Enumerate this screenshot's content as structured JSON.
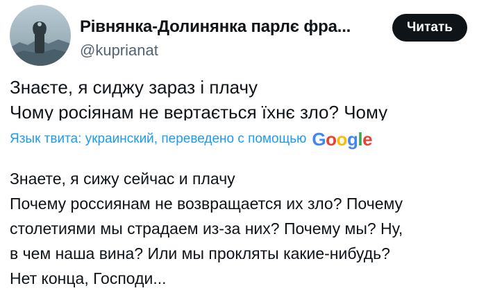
{
  "author": {
    "display_name": "Рівнянка-Долинянка парлє фра...",
    "handle": "@kuprianat",
    "avatar_icon": "profile-avatar"
  },
  "read_button_label": "Читать",
  "original_text": {
    "lines": [
      "Знаєте, я сиджу зараз і плачу",
      "Чому росіянам не вертається їхнє зло? Чому"
    ]
  },
  "translation_notice": {
    "text": "Язык твита: украинский, переведено с помощью",
    "provider_letters": [
      "G",
      "o",
      "o",
      "g",
      "l",
      "e"
    ],
    "provider_colors": [
      "#4285f4",
      "#ea4335",
      "#fbbc05",
      "#4285f4",
      "#34a853",
      "#ea4335"
    ]
  },
  "translated_text": {
    "lines": [
      "Знаете, я сижу сейчас и плачу",
      "Почему россиянам не возвращается их зло? Почему",
      "столетиями мы страдаем из-за них? Почему мы? Ну,",
      "в чем наша вина? Или мы прокляты какие-нибудь?",
      "Нет конца, Господи..."
    ]
  },
  "colors": {
    "text_primary": "#0f1419",
    "text_secondary": "#536471",
    "link_blue": "#1d9bf0",
    "button_bg": "#0f1419"
  }
}
